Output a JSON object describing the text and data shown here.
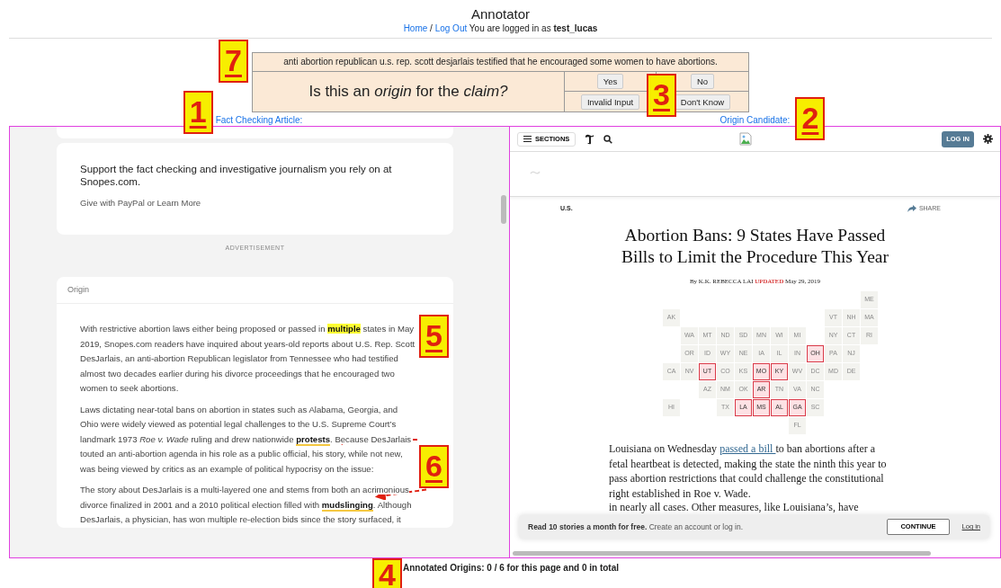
{
  "page": {
    "title": "Annotator",
    "nav_links": [
      {
        "label": "Home"
      },
      {
        "label": "Log Out"
      }
    ],
    "separator": "/",
    "login_prefix": "You are logged in as",
    "username": "test_lucas"
  },
  "claim": {
    "text": "anti abortion republican u.s. rep. scott desjarlais testified that he encouraged some women to have abortions.",
    "question": "Is this an *origin* for the *claim?*",
    "buttons": [
      {
        "label": "Yes"
      },
      {
        "label": "No"
      },
      {
        "label": "Invalid Input"
      },
      {
        "label": "Don't Know"
      }
    ]
  },
  "labels": {
    "article": "Fact Checking Article:",
    "candidate": "Origin Candidate:"
  },
  "article": {
    "support": {
      "heading": "Support the fact checking and investigative journalism you rely on at Snopes.com.",
      "line": "Give with PayPal or Learn More"
    },
    "ad_label": "ADVERTISEMENT",
    "section_title": "Origin",
    "paragraphs": [
      [
        {
          "kind": "plain",
          "text": "With restrictive abortion laws either being proposed or passed in "
        },
        {
          "kind": "highlight",
          "text": "multiple"
        },
        {
          "kind": "plain",
          "text": " states in May 2019, Snopes.com readers have inquired about years-old reports about U.S. Rep. Scott DesJarlais, an anti-abortion Republican legislator from Tennessee who had testified almost two decades earlier during his divorce proceedings that he encouraged two women to seek abortions."
        }
      ],
      [
        {
          "kind": "plain",
          "text": "Laws dictating near-total bans on abortion in states such as Alabama, Georgia, and Ohio were widely viewed as potential legal challenges to the U.S. Supreme Court’s landmark 1973 "
        },
        {
          "kind": "italic",
          "text": "Roe v. Wade"
        },
        {
          "kind": "plain",
          "text": " ruling and drew nationwide "
        },
        {
          "kind": "emphasis",
          "text": "protests"
        },
        {
          "kind": "plain",
          "text": ". Because DesJarlais touted an anti-abortion agenda in his role as a public official, his story, while not new, was being viewed by critics as an example of political hypocrisy on the issue:"
        }
      ],
      [
        {
          "kind": "plain",
          "text": "The story about DesJarlais is a multi-layered one and stems from both an acrimonious divorce finalized in 2001 and a 2010 political election filled with "
        },
        {
          "kind": "emphasis",
          "text": "mudslinging"
        },
        {
          "kind": "plain",
          "text": ". Although DesJarlais, a physician, has won multiple re-election bids since the story surfaced, it"
        }
      ]
    ]
  },
  "candidate": {
    "sections_button": "SECTIONS",
    "login_button": "LOG IN",
    "kicker": "U.S.",
    "share": "SHARE",
    "headline": "Abortion Bans: 9 States Have Passed Bills to Limit the Procedure This Year",
    "byline": {
      "author": "By K.K. REBECCA LAI",
      "updated": "UPDATED",
      "date": "May 29, 2019"
    },
    "map": {
      "rows": [
        [
          null,
          null,
          null,
          null,
          null,
          null,
          null,
          null,
          null,
          null,
          null,
          {
            "label": "ME",
            "passed": false
          }
        ],
        [
          {
            "label": "AK",
            "passed": false
          },
          null,
          null,
          null,
          null,
          null,
          null,
          null,
          null,
          {
            "label": "VT",
            "passed": false
          },
          {
            "label": "NH",
            "passed": false
          },
          {
            "label": "MA",
            "passed": false
          }
        ],
        [
          null,
          {
            "label": "WA",
            "passed": false
          },
          {
            "label": "MT",
            "passed": false
          },
          {
            "label": "ND",
            "passed": false
          },
          {
            "label": "SD",
            "passed": false
          },
          {
            "label": "MN",
            "passed": false
          },
          {
            "label": "WI",
            "passed": false
          },
          {
            "label": "MI",
            "passed": false
          },
          null,
          {
            "label": "NY",
            "passed": false
          },
          {
            "label": "CT",
            "passed": false
          },
          {
            "label": "RI",
            "passed": false
          }
        ],
        [
          null,
          {
            "label": "OR",
            "passed": false
          },
          {
            "label": "ID",
            "passed": false
          },
          {
            "label": "WY",
            "passed": false
          },
          {
            "label": "NE",
            "passed": false
          },
          {
            "label": "IA",
            "passed": false
          },
          {
            "label": "IL",
            "passed": false
          },
          {
            "label": "IN",
            "passed": false
          },
          {
            "label": "OH",
            "passed": true
          },
          {
            "label": "PA",
            "passed": false
          },
          {
            "label": "NJ",
            "passed": false
          },
          null
        ],
        [
          {
            "label": "CA",
            "passed": false
          },
          {
            "label": "NV",
            "passed": false
          },
          {
            "label": "UT",
            "passed": true
          },
          {
            "label": "CO",
            "passed": false
          },
          {
            "label": "KS",
            "passed": false
          },
          {
            "label": "MO",
            "passed": true
          },
          {
            "label": "KY",
            "passed": true
          },
          {
            "label": "WV",
            "passed": false
          },
          {
            "label": "DC",
            "passed": false
          },
          {
            "label": "MD",
            "passed": false
          },
          {
            "label": "DE",
            "passed": false
          },
          null
        ],
        [
          null,
          null,
          {
            "label": "AZ",
            "passed": false
          },
          {
            "label": "NM",
            "passed": false
          },
          {
            "label": "OK",
            "passed": false
          },
          {
            "label": "AR",
            "passed": true
          },
          {
            "label": "TN",
            "passed": false
          },
          {
            "label": "VA",
            "passed": false
          },
          {
            "label": "NC",
            "passed": false
          },
          null,
          null,
          null
        ],
        [
          {
            "label": "HI",
            "passed": false
          },
          null,
          null,
          {
            "label": "TX",
            "passed": false
          },
          {
            "label": "LA",
            "passed": true
          },
          {
            "label": "MS",
            "passed": true
          },
          {
            "label": "AL",
            "passed": true
          },
          {
            "label": "GA",
            "passed": true
          },
          {
            "label": "SC",
            "passed": false
          },
          null,
          null,
          null
        ],
        [
          null,
          null,
          null,
          null,
          null,
          null,
          null,
          {
            "label": "FL",
            "passed": false
          },
          null,
          null,
          null,
          null
        ]
      ]
    },
    "paragraph": [
      {
        "kind": "plain",
        "text": "Louisiana on Wednesday "
      },
      {
        "kind": "link",
        "text": "passed a bill "
      },
      {
        "kind": "plain",
        "text": "to ban abortions after a fetal heartbeat is detected, making the state the ninth this year to pass abortion restrictions that could challenge the constitutional right established in Roe v. Wade."
      }
    ],
    "cut_line": "in nearly all cases. Other measures, like Louisiana’s, have",
    "banner": {
      "text": "**Read 10 stories a month for free.** Create an account or log in.",
      "button": "CONTINUE",
      "link": "Log in"
    }
  },
  "status": "Annotated Origins: 0 / 6 for this page and 0 in total",
  "callouts": [
    {
      "number": "7"
    },
    {
      "number": "3"
    },
    {
      "number": "1"
    },
    {
      "number": "2"
    },
    {
      "number": "5"
    },
    {
      "number": "6"
    },
    {
      "number": "4"
    }
  ]
}
